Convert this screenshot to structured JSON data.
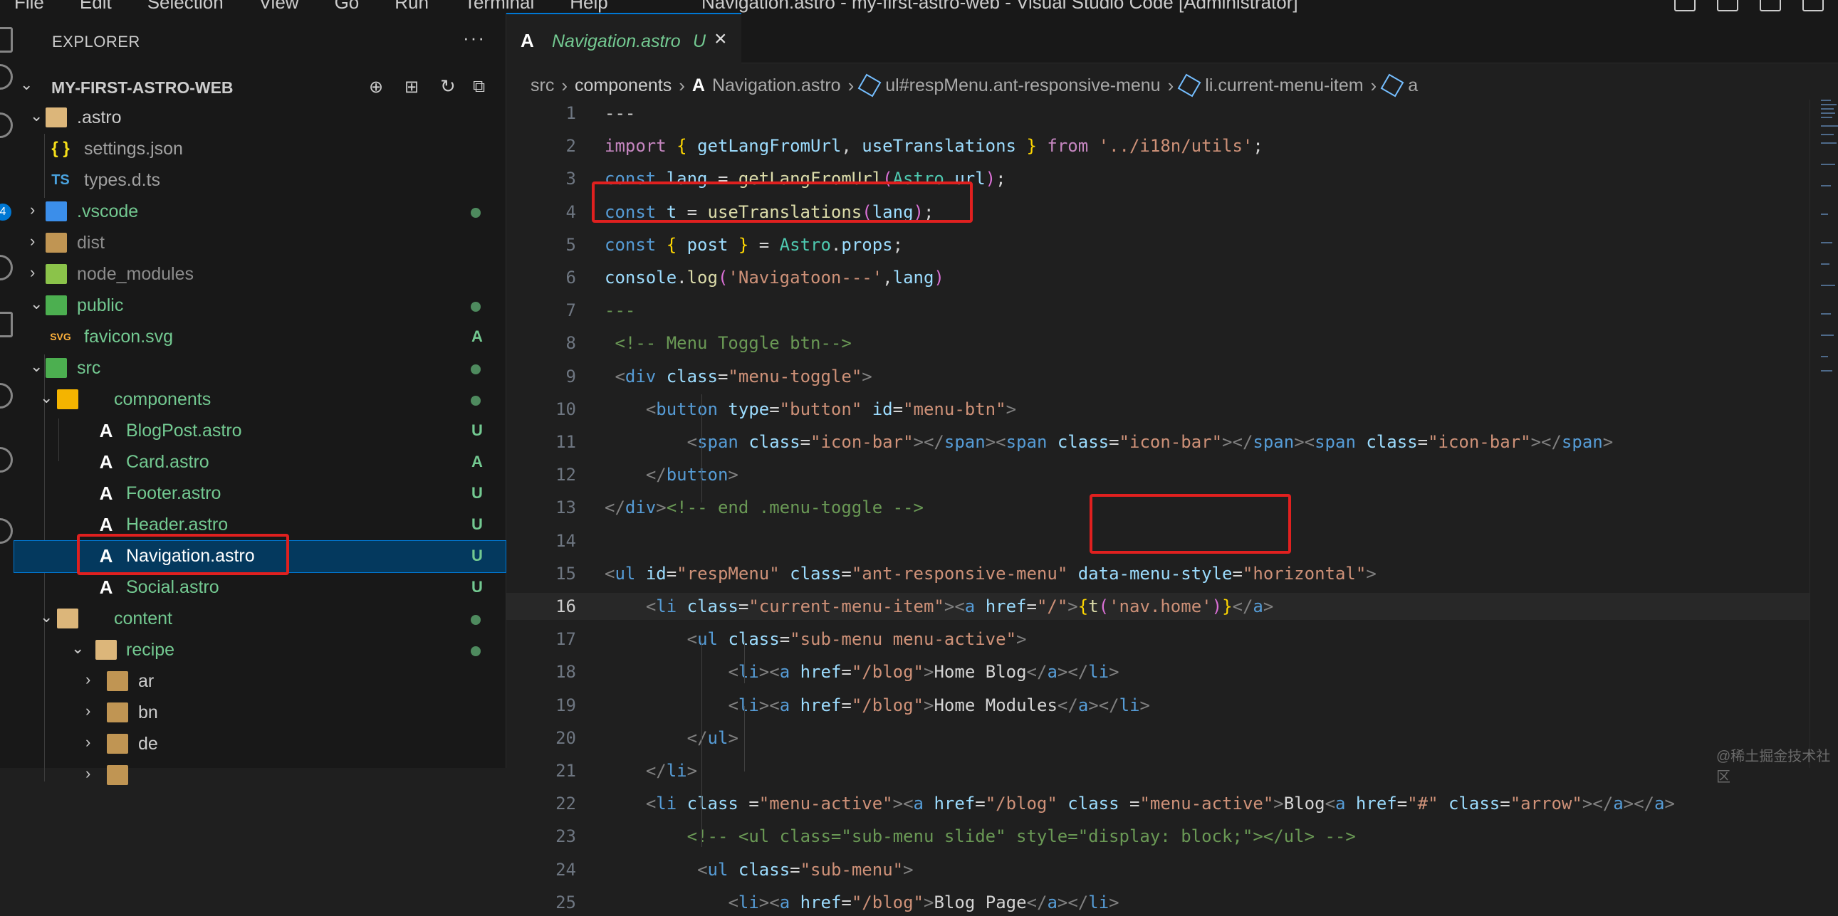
{
  "window": {
    "title": "Navigation.astro - my-first-astro-web - Visual Studio Code [Administrator]",
    "menu": [
      "File",
      "Edit",
      "Selection",
      "View",
      "Go",
      "Run",
      "Terminal",
      "Help"
    ]
  },
  "activity_bar": {
    "badge": "4"
  },
  "explorer": {
    "header": "EXPLORER",
    "more": "···",
    "root": "MY-FIRST-ASTRO-WEB",
    "items": [
      {
        "label": ".astro",
        "status": "",
        "dot": false
      },
      {
        "label": "settings.json",
        "status": "",
        "dot": false
      },
      {
        "label": "types.d.ts",
        "status": "",
        "dot": false
      },
      {
        "label": ".vscode",
        "status": "",
        "dot": true
      },
      {
        "label": "dist",
        "status": "",
        "dot": false
      },
      {
        "label": "node_modules",
        "status": "",
        "dot": false
      },
      {
        "label": "public",
        "status": "",
        "dot": true
      },
      {
        "label": "favicon.svg",
        "status": "A",
        "dot": false
      },
      {
        "label": "src",
        "status": "",
        "dot": true
      },
      {
        "label": "components",
        "status": "",
        "dot": true
      },
      {
        "label": "BlogPost.astro",
        "status": "U",
        "dot": false
      },
      {
        "label": "Card.astro",
        "status": "A",
        "dot": false
      },
      {
        "label": "Footer.astro",
        "status": "U",
        "dot": false
      },
      {
        "label": "Header.astro",
        "status": "U",
        "dot": false
      },
      {
        "label": "Navigation.astro",
        "status": "U",
        "dot": false
      },
      {
        "label": "Social.astro",
        "status": "U",
        "dot": false
      },
      {
        "label": "content",
        "status": "",
        "dot": true
      },
      {
        "label": "recipe",
        "status": "",
        "dot": true
      },
      {
        "label": "ar",
        "status": "",
        "dot": false
      },
      {
        "label": "bn",
        "status": "",
        "dot": false
      },
      {
        "label": "de",
        "status": "",
        "dot": false
      }
    ],
    "icons": {
      "json": "{ }",
      "ts": "TS",
      "svg": "SVG"
    }
  },
  "editor": {
    "tab": {
      "label": "Navigation.astro",
      "status": "U",
      "close": "×"
    },
    "breadcrumb": [
      "src",
      "components",
      "Navigation.astro",
      "ul#respMenu.ant-responsive-menu",
      "li.current-menu-item",
      "a"
    ],
    "lines": [
      {
        "n": "1",
        "t": "---"
      },
      {
        "n": "2",
        "t": "import { getLangFromUrl, useTranslations } from '../i18n/utils';"
      },
      {
        "n": "3",
        "t": "const lang = getLangFromUrl(Astro.url);"
      },
      {
        "n": "4",
        "t": "const t = useTranslations(lang);"
      },
      {
        "n": "5",
        "t": "const { post } = Astro.props;"
      },
      {
        "n": "6",
        "t": "console.log('Navigatoon---',lang)"
      },
      {
        "n": "7",
        "t": "---"
      },
      {
        "n": "8",
        "t": " <!-- Menu Toggle btn-->"
      },
      {
        "n": "9",
        "t": " <div class=\"menu-toggle\">"
      },
      {
        "n": "10",
        "t": "    <button type=\"button\" id=\"menu-btn\">"
      },
      {
        "n": "11",
        "t": "        <span class=\"icon-bar\"></span><span class=\"icon-bar\"></span><span class=\"icon-bar\"></span>"
      },
      {
        "n": "12",
        "t": "    </button>"
      },
      {
        "n": "13",
        "t": "</div><!-- end .menu-toggle -->"
      },
      {
        "n": "14",
        "t": ""
      },
      {
        "n": "15",
        "t": "<ul id=\"respMenu\" class=\"ant-responsive-menu\" data-menu-style=\"horizontal\">"
      },
      {
        "n": "16",
        "t": "    <li class=\"current-menu-item\"><a href=\"/\">{t('nav.home')}</a>"
      },
      {
        "n": "17",
        "t": "        <ul class=\"sub-menu menu-active\">"
      },
      {
        "n": "18",
        "t": "            <li><a href=\"/blog\">Home Blog</a></li>"
      },
      {
        "n": "19",
        "t": "            <li><a href=\"/blog\">Home Modules</a></li>"
      },
      {
        "n": "20",
        "t": "        </ul>"
      },
      {
        "n": "21",
        "t": "    </li>"
      },
      {
        "n": "22",
        "t": "    <li class =\"menu-active\"><a href=\"/blog\" class =\"menu-active\">Blog<a href=\"#\" class=\"arrow\"></a></a>"
      },
      {
        "n": "23",
        "t": "        <!-- <ul class=\"sub-menu slide\" style=\"display: block;\"></ul> -->"
      },
      {
        "n": "24",
        "t": "         <ul class=\"sub-menu\">"
      },
      {
        "n": "25",
        "t": "            <li><a href=\"/blog\">Blog Page</a></li>"
      }
    ]
  },
  "watermark": "@稀土掘金技术社区"
}
